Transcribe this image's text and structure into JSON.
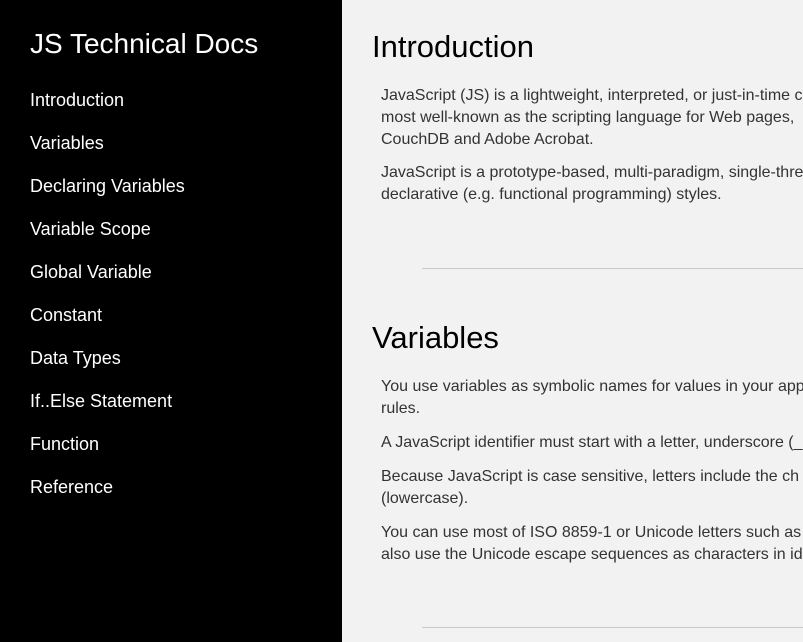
{
  "nav": {
    "title": "JS Technical Docs",
    "items": [
      {
        "label": "Introduction"
      },
      {
        "label": "Variables"
      },
      {
        "label": "Declaring Variables"
      },
      {
        "label": "Variable Scope"
      },
      {
        "label": "Global Variable"
      },
      {
        "label": "Constant"
      },
      {
        "label": "Data Types"
      },
      {
        "label": "If..Else Statement"
      },
      {
        "label": "Function"
      },
      {
        "label": "Reference"
      }
    ]
  },
  "sections": {
    "introduction": {
      "title": "Introduction",
      "p1": [
        "JavaScript (JS) is a lightweight, interpreted, or just-in-time c",
        "most well-known as the scripting language for Web pages,",
        "CouchDB and Adobe Acrobat."
      ],
      "p2": [
        "JavaScript is a prototype-based, multi-paradigm, single-thre",
        "declarative (e.g. functional programming) styles."
      ]
    },
    "variables": {
      "title": "Variables",
      "p1": [
        "You use variables as symbolic names for values in your app",
        "rules."
      ],
      "p2": [
        "A JavaScript identifier must start with a letter, underscore (_"
      ],
      "p3": [
        "Because JavaScript is case sensitive, letters include the ch",
        "(lowercase)."
      ],
      "p4": [
        "You can use most of ISO 8859-1 or Unicode letters such as",
        "also use the Unicode escape sequences as characters in id"
      ]
    }
  }
}
